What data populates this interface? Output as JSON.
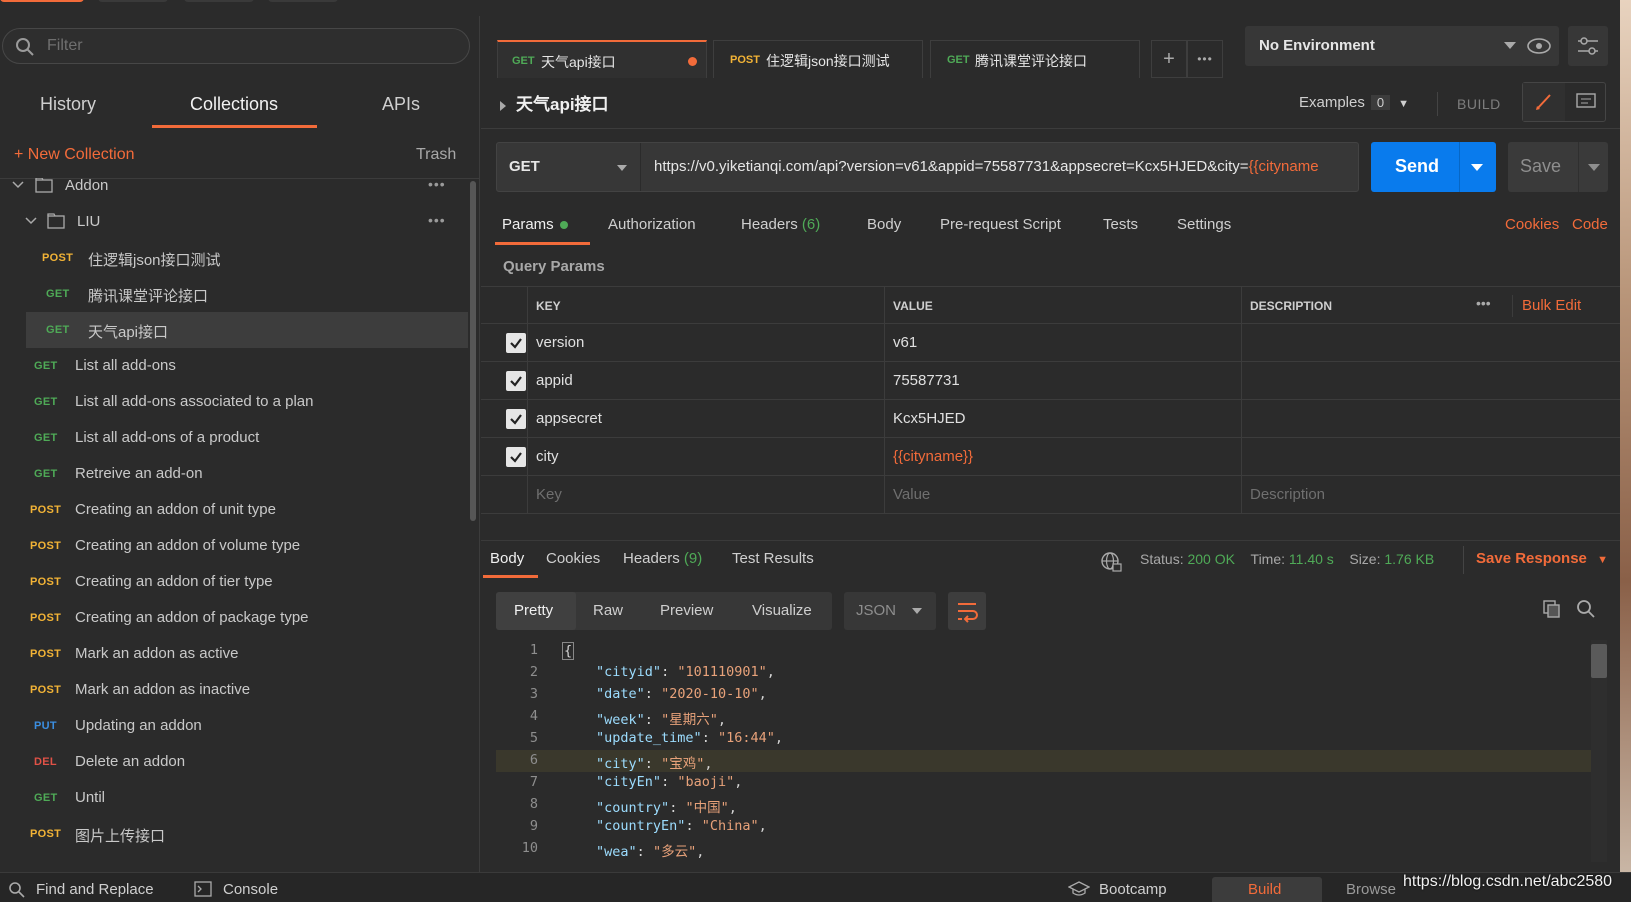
{
  "sidebar": {
    "filter_placeholder": "Filter",
    "tabs": [
      "History",
      "Collections",
      "APIs"
    ],
    "new_collection": "New Collection",
    "trash": "Trash",
    "tree": [
      {
        "type": "folder",
        "label": "Addon"
      },
      {
        "type": "folder",
        "label": "LIU"
      },
      {
        "method": "POST",
        "label": "住逻辑json接口测试"
      },
      {
        "method": "GET",
        "label": "腾讯课堂评论接口"
      },
      {
        "method": "GET",
        "label": "天气api接口"
      },
      {
        "method": "GET",
        "label": "List all add-ons"
      },
      {
        "method": "GET",
        "label": "List all add-ons associated to a plan"
      },
      {
        "method": "GET",
        "label": "List all add-ons of a product"
      },
      {
        "method": "GET",
        "label": "Retreive an add-on"
      },
      {
        "method": "POST",
        "label": "Creating an addon of unit type"
      },
      {
        "method": "POST",
        "label": "Creating an addon of volume type"
      },
      {
        "method": "POST",
        "label": "Creating an addon of tier type"
      },
      {
        "method": "POST",
        "label": "Creating an addon of package type"
      },
      {
        "method": "POST",
        "label": "Mark an addon as active"
      },
      {
        "method": "POST",
        "label": "Mark an addon as inactive"
      },
      {
        "method": "PUT",
        "label": "Updating an addon"
      },
      {
        "method": "DEL",
        "label": "Delete an addon"
      },
      {
        "method": "GET",
        "label": "Until"
      },
      {
        "method": "POST",
        "label": "图片上传接口"
      }
    ]
  },
  "request_tabs": [
    {
      "method": "GET",
      "label": "天气api接口"
    },
    {
      "method": "POST",
      "label": "住逻辑json接口测试"
    },
    {
      "method": "GET",
      "label": "腾讯课堂评论接口"
    }
  ],
  "environment": "No Environment",
  "request": {
    "title": "天气api接口",
    "examples_label": "Examples",
    "examples_count": "0",
    "build_label": "BUILD",
    "method": "GET",
    "url_plain": "https://v0.yiketianqi.com/api?version=v61&appid=75587731&appsecret=Kcx5HJED&city=",
    "url_var": "{{cityname",
    "send": "Send",
    "save": "Save"
  },
  "req_tabs": {
    "params": "Params",
    "authorization": "Authorization",
    "headers": "Headers",
    "headers_count": "(6)",
    "body": "Body",
    "prereq": "Pre-request Script",
    "tests": "Tests",
    "settings": "Settings",
    "cookies": "Cookies",
    "code": "Code"
  },
  "query_params": {
    "label": "Query Params",
    "headers": {
      "key": "KEY",
      "value": "VALUE",
      "description": "DESCRIPTION",
      "bulk_edit": "Bulk Edit"
    },
    "rows": [
      {
        "key": "version",
        "value": "v61"
      },
      {
        "key": "appid",
        "value": "75587731"
      },
      {
        "key": "appsecret",
        "value": "Kcx5HJED"
      },
      {
        "key": "city",
        "value": "{{cityname}}"
      }
    ],
    "placeholder": {
      "key": "Key",
      "value": "Value",
      "description": "Description"
    }
  },
  "response": {
    "tabs": {
      "body": "Body",
      "cookies": "Cookies",
      "headers": "Headers",
      "headers_count": "(9)",
      "test_results": "Test Results"
    },
    "status_label": "Status:",
    "status": "200 OK",
    "time_label": "Time:",
    "time": "11.40 s",
    "size_label": "Size:",
    "size": "1.76 KB",
    "save_response": "Save Response",
    "formats": [
      "Pretty",
      "Raw",
      "Preview",
      "Visualize"
    ],
    "format_type": "JSON",
    "code_lines": [
      {
        "n": "1",
        "text": "{"
      },
      {
        "n": "2",
        "k": "cityid",
        "v": "101110901"
      },
      {
        "n": "3",
        "k": "date",
        "v": "2020-10-10"
      },
      {
        "n": "4",
        "k": "week",
        "v": "星期六"
      },
      {
        "n": "5",
        "k": "update_time",
        "v": "16:44"
      },
      {
        "n": "6",
        "k": "city",
        "v": "宝鸡"
      },
      {
        "n": "7",
        "k": "cityEn",
        "v": "baoji"
      },
      {
        "n": "8",
        "k": "country",
        "v": "中国"
      },
      {
        "n": "9",
        "k": "countryEn",
        "v": "China"
      },
      {
        "n": "10",
        "k": "wea",
        "v": "多云"
      }
    ]
  },
  "bottom_bar": {
    "find_replace": "Find and Replace",
    "console": "Console",
    "bootcamp": "Bootcamp",
    "build": "Build",
    "browse": "Browse"
  },
  "watermark": "https://blog.csdn.net/abc2580",
  "colors": {
    "accent": "#f26b3a",
    "send": "#097bed",
    "get": "#4faa57",
    "post": "#f2b336",
    "put": "#3b8ee0",
    "del": "#e15247"
  }
}
